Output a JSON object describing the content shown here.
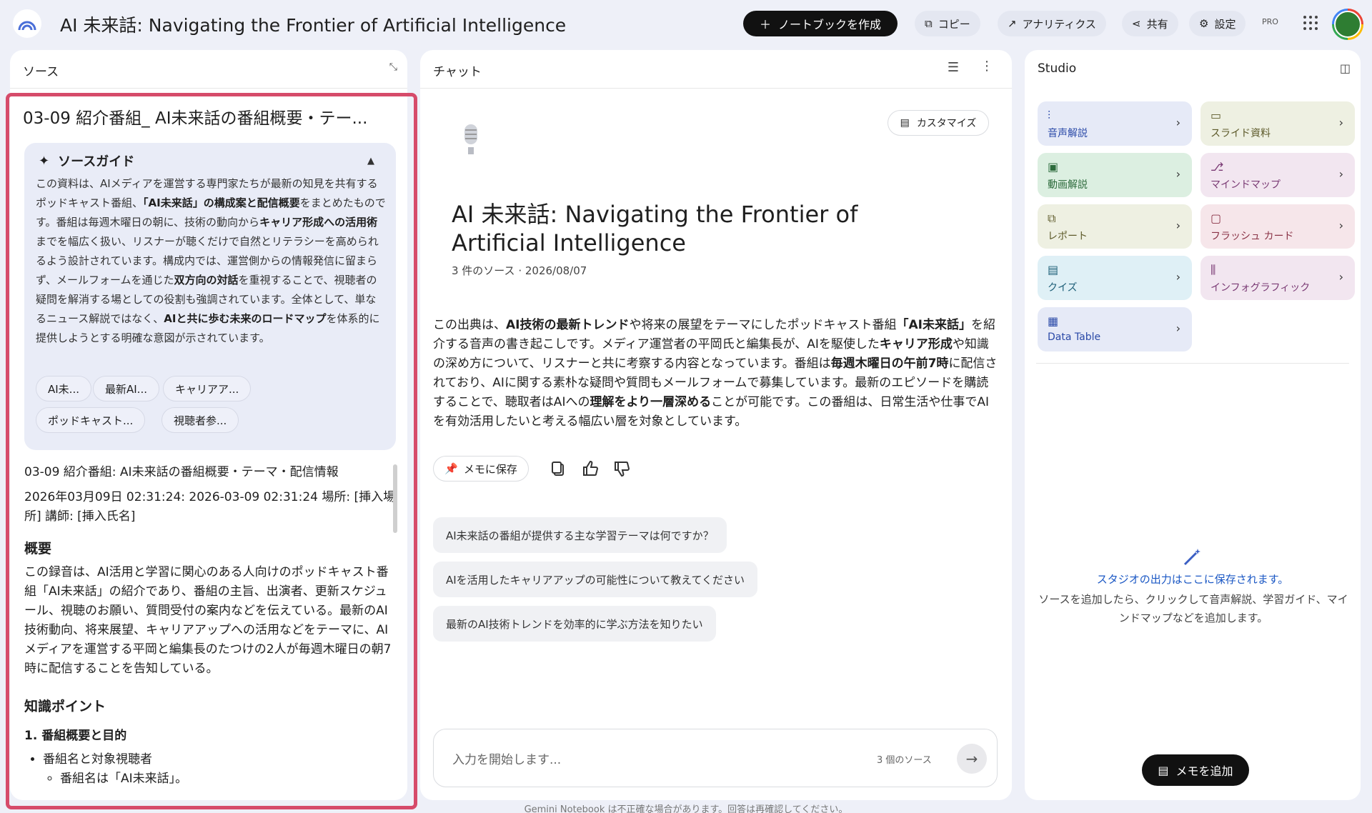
{
  "app": {
    "title": "AI 未来話: Navigating the Frontier of Artificial Intelligence",
    "create_button": "ノートブックを作成",
    "copy": "コピー",
    "analytics": "アナリティクス",
    "share": "共有",
    "settings": "設定",
    "pro_badge": "PRO"
  },
  "sources": {
    "panel_title": "ソース",
    "doc_title": "03-09 紹介番組_ AI未来話の番組概要・テー...",
    "guide": {
      "title": "ソースガイド",
      "parts": [
        {
          "t": "この資料は、AIメディアを運営する専門家たちが最新の知見を共有するポッドキャスト番組、",
          "b": false
        },
        {
          "t": "「AI未来話」の構成案と配信概要",
          "b": true
        },
        {
          "t": "をまとめたものです。番組は毎週木曜日の朝に、技術の動向から",
          "b": false
        },
        {
          "t": "キャリア形成への活用術",
          "b": true
        },
        {
          "t": "までを幅広く扱い、リスナーが聴くだけで自然とリテラシーを高められるよう設計されています。構成内では、運営側からの情報発信に留まらず、メールフォームを通じた",
          "b": false
        },
        {
          "t": "双方向の対話",
          "b": true
        },
        {
          "t": "を重視することで、視聴者の疑問を解消する場としての役割も強調されています。全体として、単なるニュース解説ではなく、",
          "b": false
        },
        {
          "t": "AIと共に歩む未来のロードマップ",
          "b": true
        },
        {
          "t": "を体系的に提供しようとする明確な意図が示されています。",
          "b": false
        }
      ],
      "chips": [
        "AI未...",
        "最新AI...",
        "キャリアア...",
        "ポッドキャスト...",
        "視聴者参..."
      ]
    },
    "body": {
      "header": "03-09 紹介番組: AI未来話の番組概要・テーマ・配信情報",
      "meta": "2026年03月09日 02:31:24: 2026-03-09 02:31:24 場所: [挿入場所] 講師: [挿入氏名]",
      "h_overview": "概要",
      "overview": "この録音は、AI活用と学習に関心のある人向けのポッドキャスト番組「AI未来話」の紹介であり、番組の主旨、出演者、更新スケジュール、視聴のお願い、質問受付の案内などを伝えている。最新のAI技術動向、将来展望、キャリアアップへの活用などをテーマに、AIメディアを運営する平岡と編集長のたつけの2人が毎週木曜日の朝7時に配信することを告知している。",
      "h_points": "知識ポイント",
      "h_section1": "1. 番組概要と目的",
      "bullet1": "番組名と対象視聴者",
      "sub1": "番組名は「AI未来話」。"
    }
  },
  "chat": {
    "panel_title": "チャット",
    "customize": "カスタマイズ",
    "title": "AI 未来話: Navigating the Frontier of Artificial Intelligence",
    "meta": "3 件のソース · 2026/08/07",
    "summary_parts": [
      {
        "t": "この出典は、",
        "b": false
      },
      {
        "t": "AI技術の最新トレンド",
        "b": true
      },
      {
        "t": "や将来の展望をテーマにしたポッドキャスト番組",
        "b": false
      },
      {
        "t": "「AI未来話」",
        "b": true
      },
      {
        "t": "を紹介する音声の書き起こしです。メディア運営者の平岡氏と編集長が、AIを駆使した",
        "b": false
      },
      {
        "t": "キャリア形成",
        "b": true
      },
      {
        "t": "や知識の深め方について、リスナーと共に考察する内容となっています。番組は",
        "b": false
      },
      {
        "t": "毎週木曜日の午前7時",
        "b": true
      },
      {
        "t": "に配信されており、AIに関する素朴な疑問や質問もメールフォームで募集しています。最新のエピソードを購読することで、聴取者はAIへの",
        "b": false
      },
      {
        "t": "理解をより一層深める",
        "b": true
      },
      {
        "t": "ことが可能です。この番組は、日常生活や仕事でAIを有効活用したいと考える幅広い層を対象としています。",
        "b": false
      }
    ],
    "save_memo": "メモに保存",
    "suggestions": [
      "AI未来話の番組が提供する主な学習テーマは何ですか？",
      "AIを活用したキャリアアップの可能性について教えてください",
      "最新のAI技術トレンドを効率的に学ぶ方法を知りたい"
    ],
    "input_placeholder": "入力を開始します...",
    "source_count": "3 個のソース",
    "disclaimer": "Gemini Notebook は不正確な場合があります。回答は再確認してください。"
  },
  "studio": {
    "panel_title": "Studio",
    "tiles": [
      {
        "label": "音声解説",
        "color": "#e6eaf7",
        "text": "#2b4aa8"
      },
      {
        "label": "スライド資料",
        "color": "#eef0e2",
        "text": "#5d5a2a"
      },
      {
        "label": "動画解説",
        "color": "#dcefe1",
        "text": "#2d6b3c"
      },
      {
        "label": "マインドマップ",
        "color": "#f2e6f0",
        "text": "#7a3a74"
      },
      {
        "label": "レポート",
        "color": "#eef0e2",
        "text": "#5d5a2a"
      },
      {
        "label": "フラッシュ カード",
        "color": "#f6e6ea",
        "text": "#8a3346"
      },
      {
        "label": "クイズ",
        "color": "#dff0f6",
        "text": "#1e5f78"
      },
      {
        "label": "インフォグラフィック",
        "color": "#f2e6f0",
        "text": "#7a3a74"
      },
      {
        "label": "Data Table",
        "color": "#e6eaf7",
        "text": "#2b4aa8"
      }
    ],
    "empty_title": "スタジオの出力はここに保存されます。",
    "empty_desc": "ソースを追加したら、クリックして音声解説、学習ガイド、マインドマップなどを追加します。",
    "add_note": "メモを追加"
  }
}
